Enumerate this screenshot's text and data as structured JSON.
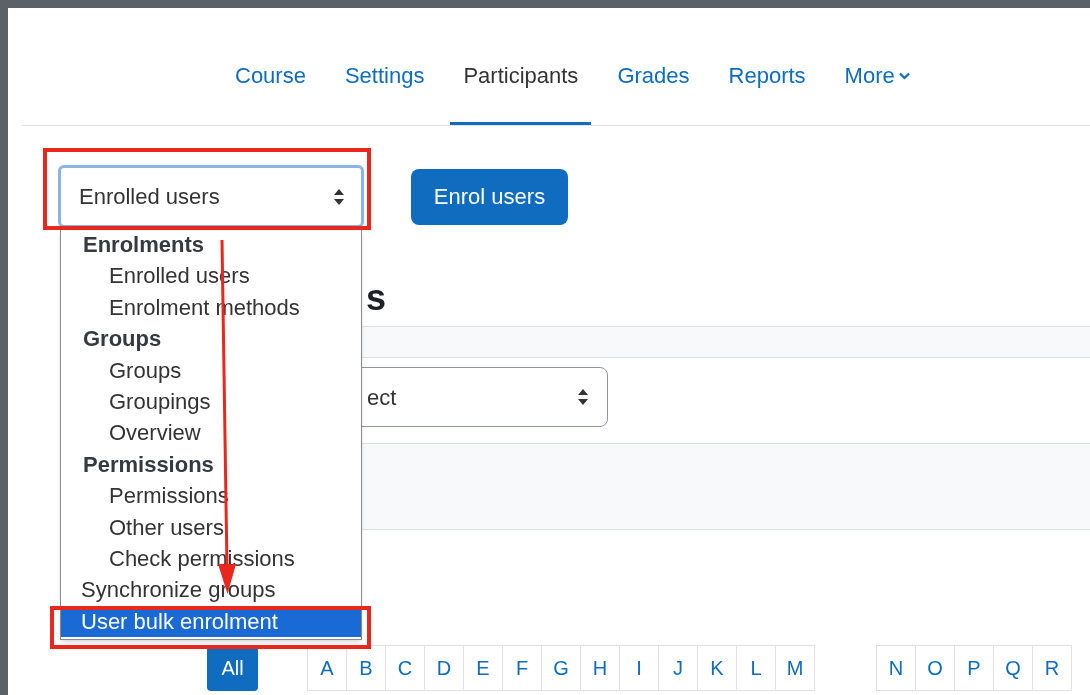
{
  "nav": {
    "tabs": [
      {
        "label": "Course",
        "selected": false
      },
      {
        "label": "Settings",
        "selected": false
      },
      {
        "label": "Participants",
        "selected": true
      },
      {
        "label": "Grades",
        "selected": false
      },
      {
        "label": "Reports",
        "selected": false
      },
      {
        "label": "More",
        "selected": false,
        "kind": "menu"
      }
    ]
  },
  "view_select": {
    "value": "Enrolled users"
  },
  "enrol_button": "Enrol users",
  "heading_fragment": "s",
  "filter_select": {
    "value": "ect"
  },
  "initials": {
    "all": {
      "label": "All",
      "selected": true
    },
    "letters": [
      "A",
      "B",
      "C",
      "D",
      "E",
      "F",
      "G",
      "H",
      "I",
      "J",
      "K",
      "L",
      "M"
    ],
    "letters_2": [
      "N",
      "O",
      "P",
      "Q",
      "R"
    ]
  },
  "menu": [
    {
      "kind": "group",
      "label": "Enrolments"
    },
    {
      "kind": "option",
      "label": "Enrolled users",
      "selected": false
    },
    {
      "kind": "option",
      "label": "Enrolment methods",
      "selected": false
    },
    {
      "kind": "group",
      "label": "Groups"
    },
    {
      "kind": "option",
      "label": "Groups",
      "selected": false
    },
    {
      "kind": "option",
      "label": "Groupings",
      "selected": false
    },
    {
      "kind": "option",
      "label": "Overview",
      "selected": false
    },
    {
      "kind": "group",
      "label": "Permissions"
    },
    {
      "kind": "option",
      "label": "Permissions",
      "selected": false
    },
    {
      "kind": "option",
      "label": "Other users",
      "selected": false
    },
    {
      "kind": "option",
      "label": "Check permissions",
      "selected": false
    },
    {
      "kind": "top_option",
      "label": "Synchronize groups",
      "selected": false
    },
    {
      "kind": "top_option",
      "label": "User bulk enrolment",
      "selected": true
    }
  ]
}
